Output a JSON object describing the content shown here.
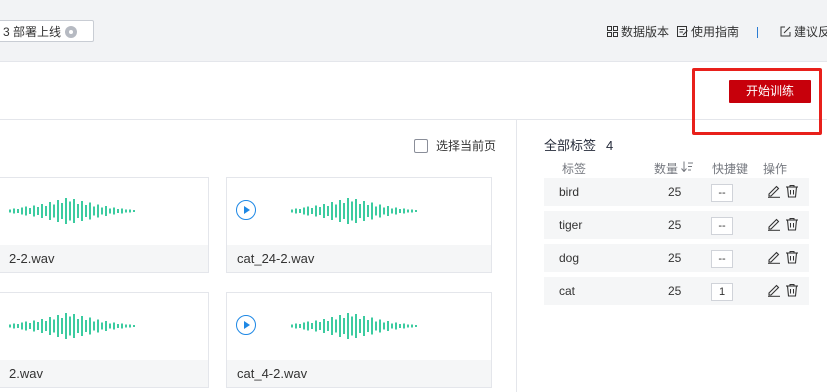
{
  "topbar": {
    "step_label": "3 部署上线",
    "data_version": "数据版本",
    "usage_guide": "使用指南",
    "feedback": "建议反"
  },
  "actions": {
    "start_training": "开始训练"
  },
  "gallery": {
    "select_current_page": "选择当前页",
    "cards": [
      {
        "name": "2-2.wav"
      },
      {
        "name": "cat_24-2.wav"
      },
      {
        "name": "2.wav"
      },
      {
        "name": "cat_4-2.wav"
      }
    ]
  },
  "labels": {
    "title": "全部标签",
    "count": "4",
    "headers": {
      "label": "标签",
      "count": "数量",
      "shortcut": "快捷键",
      "ops": "操作"
    },
    "rows": [
      {
        "label": "bird",
        "count": "25",
        "key": "--"
      },
      {
        "label": "tiger",
        "count": "25",
        "key": "--"
      },
      {
        "label": "dog",
        "count": "25",
        "key": "--"
      },
      {
        "label": "cat",
        "count": "25",
        "key": "1"
      }
    ]
  },
  "colors": {
    "primary_red": "#c7000b",
    "highlight": "#e8201b",
    "wave": "#3ccba0",
    "play": "#1e88e5"
  },
  "icons": [
    "stop-circle-icon",
    "grid-icon",
    "guide-icon",
    "feedback-icon",
    "play-icon",
    "waveform-icon",
    "sort-icon",
    "edit-icon",
    "trash-icon",
    "checkbox-icon"
  ]
}
